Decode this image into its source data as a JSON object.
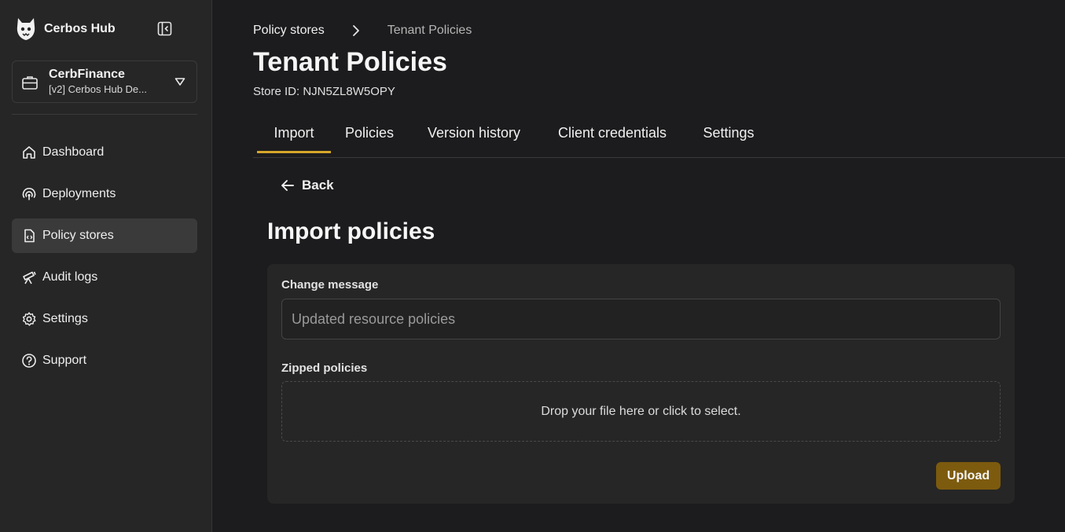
{
  "app": {
    "name": "Cerbos Hub"
  },
  "colors": {
    "accent": "#d6a62a",
    "button": "#7d5b0e",
    "background": "#1c1c1e",
    "sidebar": "#262626"
  },
  "org": {
    "name": "CerbFinance",
    "workspace": "[v2] Cerbos Hub De..."
  },
  "sidebar": {
    "items": [
      {
        "label": "Dashboard",
        "icon": "home-icon"
      },
      {
        "label": "Deployments",
        "icon": "broadcast-icon"
      },
      {
        "label": "Policy stores",
        "icon": "file-code-icon",
        "active": true
      },
      {
        "label": "Audit logs",
        "icon": "telescope-icon"
      },
      {
        "label": "Settings",
        "icon": "gear-icon"
      },
      {
        "label": "Support",
        "icon": "help-circle-icon"
      }
    ]
  },
  "breadcrumb": {
    "parent": "Policy stores",
    "current": "Tenant Policies"
  },
  "page": {
    "title": "Tenant Policies",
    "store_id": "Store ID: NJN5ZL8W5OPY"
  },
  "tabs": [
    {
      "label": "Import",
      "active": true
    },
    {
      "label": "Policies"
    },
    {
      "label": "Version history"
    },
    {
      "label": "Client credentials"
    },
    {
      "label": "Settings"
    }
  ],
  "import": {
    "back_label": "Back",
    "title": "Import policies",
    "message_label": "Change message",
    "message_placeholder": "Updated resource policies",
    "message_value": "",
    "zip_label": "Zipped policies",
    "dropzone_text": "Drop your file here or click to select.",
    "upload_label": "Upload"
  }
}
